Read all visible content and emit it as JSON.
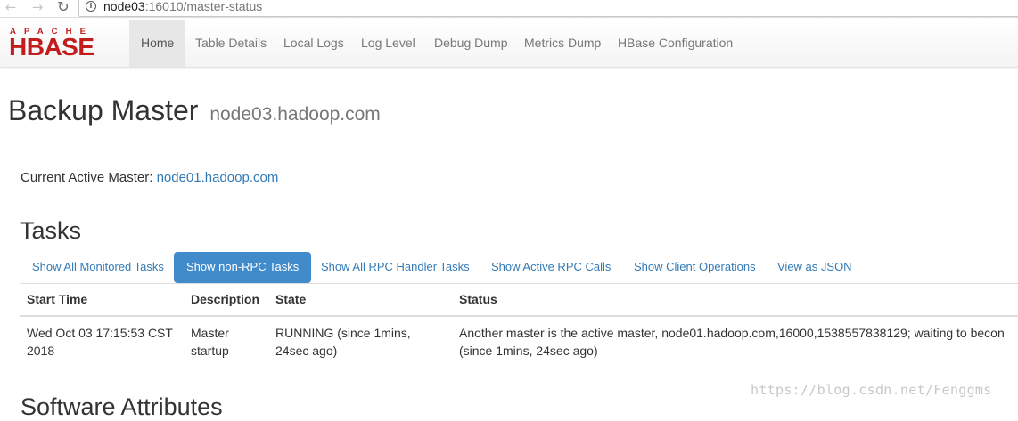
{
  "browser": {
    "url_host": "node03",
    "url_rest": ":16010/master-status",
    "info_icon_glyph": "i"
  },
  "logo": {
    "top": "APACHE",
    "main": "HBASE",
    "color": "#c31c1c"
  },
  "navbar": {
    "items": [
      {
        "label": "Home",
        "active": true
      },
      {
        "label": "Table Details"
      },
      {
        "label": "Local Logs"
      },
      {
        "label": "Log Level"
      },
      {
        "label": "Debug Dump"
      },
      {
        "label": "Metrics Dump"
      },
      {
        "label": "HBase Configuration"
      }
    ]
  },
  "header": {
    "title": "Backup Master",
    "host": "node03.hadoop.com"
  },
  "active_master": {
    "label": "Current Active Master:",
    "link": "node01.hadoop.com"
  },
  "tasks": {
    "heading": "Tasks",
    "pills": [
      {
        "label": "Show All Monitored Tasks"
      },
      {
        "label": "Show non-RPC Tasks",
        "active": true
      },
      {
        "label": "Show All RPC Handler Tasks"
      },
      {
        "label": "Show Active RPC Calls"
      },
      {
        "label": "Show Client Operations"
      },
      {
        "label": "View as JSON"
      }
    ],
    "columns": [
      "Start Time",
      "Description",
      "State",
      "Status"
    ],
    "rows": [
      {
        "start_line1": "Wed Oct 03 17:15:53 CST",
        "start_line2": "2018",
        "desc_line1": "Master",
        "desc_line2": "startup",
        "state_line1": "RUNNING (since 1mins,",
        "state_line2": "24sec ago)",
        "status_line1": "Another master is the active master, node01.hadoop.com,16000,1538557838129; waiting to becon",
        "status_line2": "(since 1mins, 24sec ago)"
      }
    ]
  },
  "software": {
    "heading": "Software Attributes"
  },
  "watermark": "https://blog.csdn.net/Fenggms",
  "colors": {
    "link": "#337ab7",
    "pill_active": "#428bca"
  }
}
